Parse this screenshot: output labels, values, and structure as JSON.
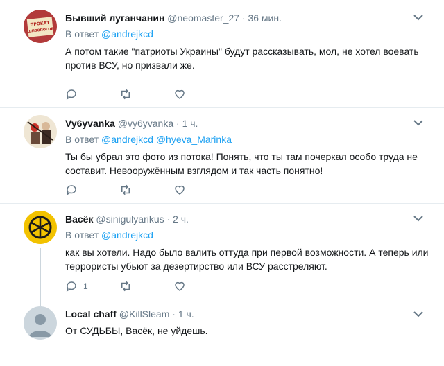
{
  "tweets": [
    {
      "name": "Бывший луганчанин",
      "handle": "@neomaster_27",
      "time": "36 мин.",
      "reply_prefix": "В ответ",
      "mentions": "@andrejkcd",
      "text": "А потом такие \"патриоты Украины\" будут рассказывать, мол, не хотел воевать против ВСУ, но призвали же.",
      "avatar_sign": "ПРОКАТ\nШИЗОПОГОВ",
      "reply_count": ""
    },
    {
      "name": "Vy6yvanka",
      "handle": "@vy6yvanka",
      "time": "1 ч.",
      "reply_prefix": "В ответ",
      "mentions": "@andrejkcd @hyeva_Marinka",
      "text": "Ты бы убрал это фото из потока! Понять, что ты там почеркал особо труда не составит. Невооружённым взглядом и так часть понятно!",
      "reply_count": ""
    },
    {
      "name": "Васёк",
      "handle": "@sinigulyarikus",
      "time": "2 ч.",
      "reply_prefix": "В ответ",
      "mentions": "@andrejkcd",
      "text": "как вы хотели. Надо было валить оттуда при первой возможности. А теперь или террористы убьют за дезертирство или ВСУ расстреляют.",
      "reply_count": "1"
    },
    {
      "name": "Local chaff",
      "handle": "@KillSleam",
      "time": "1 ч.",
      "text": "От СУДЬБЫ, Васёк, не уйдешь."
    }
  ],
  "dot": "·",
  "colors": {
    "accent": "#1da1f2",
    "muted": "#657786",
    "text": "#14171a",
    "divider": "#e6ecf0"
  }
}
